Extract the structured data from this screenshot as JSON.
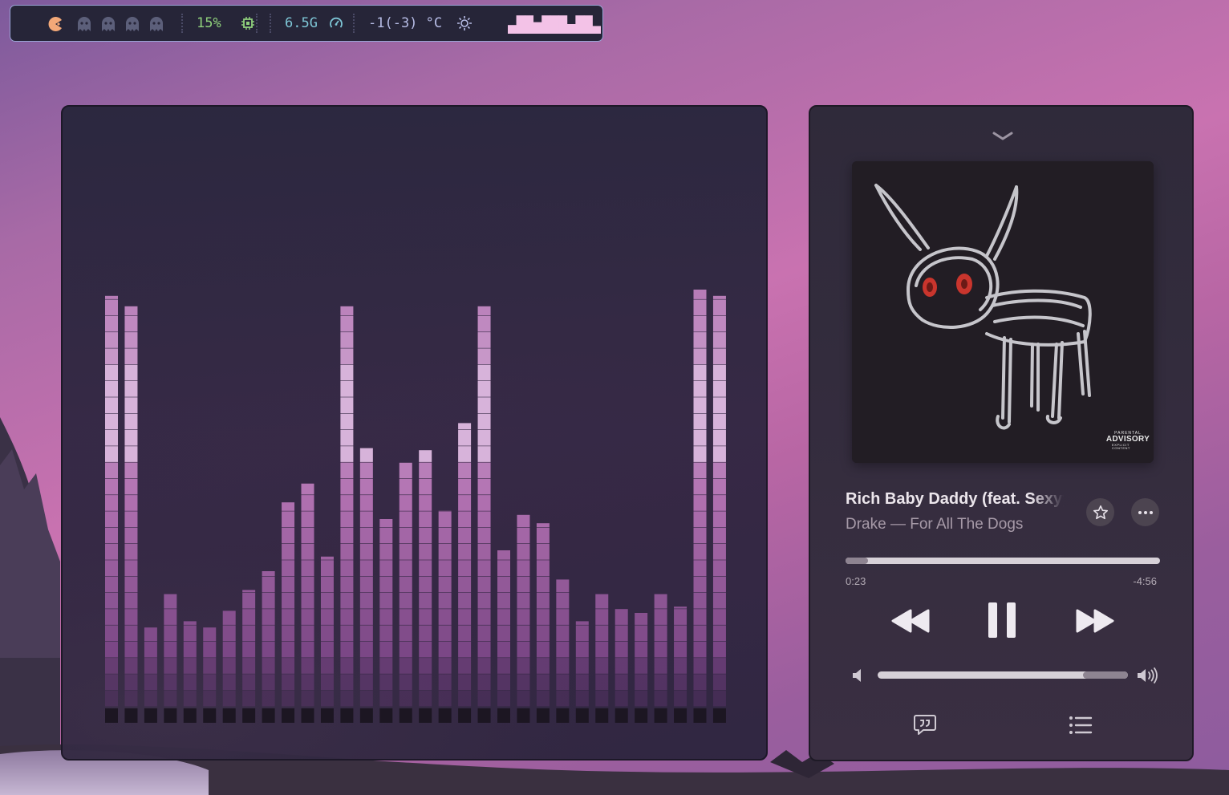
{
  "status_bar": {
    "cpu": {
      "value": "15%",
      "icon": "chip-icon",
      "color": "#8fd07c"
    },
    "memory": {
      "value": "6.5G",
      "icon": "gauge-icon",
      "color": "#7ec6d6"
    },
    "temperature": {
      "value": "-1(-3) °C",
      "icon": "sun-icon",
      "color": "#b7bde6"
    },
    "workspaces": [
      "pacman-active",
      "ghost",
      "ghost",
      "ghost",
      "ghost"
    ],
    "sparkline_levels": [
      0.45,
      0.95,
      0.95,
      0.6,
      0.95,
      0.95,
      0.95,
      0.5,
      0.95,
      0.95,
      0.4
    ],
    "accent": "#f3c2e7"
  },
  "visualizer": {
    "bar_levels": [
      0.985,
      0.96,
      0.19,
      0.27,
      0.205,
      0.19,
      0.23,
      0.28,
      0.325,
      0.49,
      0.535,
      0.36,
      0.96,
      0.62,
      0.45,
      0.585,
      0.615,
      0.47,
      0.68,
      0.96,
      0.375,
      0.46,
      0.44,
      0.305,
      0.205,
      0.27,
      0.235,
      0.225,
      0.27,
      0.24,
      1.0,
      0.985
    ],
    "colors": {
      "bottom": "#6a3a78",
      "mid": "#b070b0",
      "top": "#e8d0ec"
    }
  },
  "player": {
    "collapse_icon": "chevron-down-icon",
    "track_title": "Rich Baby Daddy (feat. Sexyy Red & SZA)",
    "subtitle": "Drake — For All The Dogs",
    "advisory": {
      "line1": "PARENTAL",
      "line2": "ADVISORY",
      "line3": "EXPLICIT CONTENT"
    },
    "favorite_icon": "star-icon",
    "more_icon": "ellipsis-icon",
    "progress": 0.072,
    "elapsed": "0:23",
    "remaining": "-4:56",
    "controls": [
      "rewind-icon",
      "pause-icon",
      "fast-forward-icon"
    ],
    "volume": 0.82,
    "bottom_icons": [
      "lyrics-icon",
      "queue-list-icon"
    ]
  }
}
